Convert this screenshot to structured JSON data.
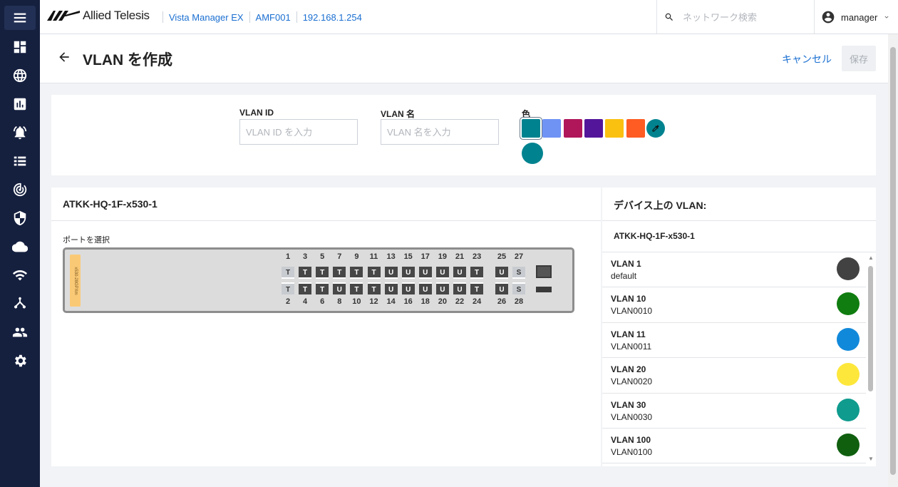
{
  "header": {
    "brand": "Allied Telesis",
    "breadcrumbs": [
      "Vista Manager EX",
      "AMF001",
      "192.168.1.254"
    ],
    "search_placeholder": "ネットワーク検索",
    "user": "manager"
  },
  "sidebar": {
    "icons": [
      "menu-icon",
      "dashboard-icon",
      "globe-icon",
      "chart-icon",
      "alarm-icon",
      "list-icon",
      "radar-icon",
      "shield-icon",
      "cloud-icon",
      "wifi-icon",
      "topology-icon",
      "users-icon",
      "gear-icon"
    ]
  },
  "page": {
    "title": "VLAN を作成",
    "cancel_label": "キャンセル",
    "save_label": "保存"
  },
  "form": {
    "vlan_id_label": "VLAN ID",
    "vlan_id_placeholder": "VLAN ID を入力",
    "vlan_name_label": "VLAN 名",
    "vlan_name_placeholder": "VLAN 名を入力",
    "color_label": "色",
    "swatches": [
      "#00838f",
      "#6f93f5",
      "#b0165a",
      "#53169a",
      "#fbc111",
      "#fe5c23"
    ],
    "selected_color": "#00838f"
  },
  "device": {
    "name": "ATKK-HQ-1F-x530-1",
    "port_select_label": "ポートを選択",
    "model": "x530-28GPXm",
    "top_ports": [
      {
        "n": "1",
        "m": "T",
        "s": "lt"
      },
      {
        "n": "3",
        "m": "T",
        "s": "dk"
      },
      {
        "n": "5",
        "m": "T",
        "s": "dk"
      },
      {
        "n": "7",
        "m": "T",
        "s": "dk"
      },
      {
        "n": "9",
        "m": "T",
        "s": "dk"
      },
      {
        "n": "11",
        "m": "T",
        "s": "dk"
      },
      {
        "n": "13",
        "m": "U",
        "s": "dk"
      },
      {
        "n": "15",
        "m": "U",
        "s": "dk"
      },
      {
        "n": "17",
        "m": "U",
        "s": "dk"
      },
      {
        "n": "19",
        "m": "U",
        "s": "dk"
      },
      {
        "n": "21",
        "m": "U",
        "s": "dk"
      },
      {
        "n": "23",
        "m": "T",
        "s": "dk"
      },
      {
        "n": "25",
        "m": "U",
        "s": "dk"
      },
      {
        "n": "27",
        "m": "S",
        "s": "lt"
      }
    ],
    "bottom_ports": [
      {
        "n": "2",
        "m": "T",
        "s": "lt"
      },
      {
        "n": "4",
        "m": "T",
        "s": "dk"
      },
      {
        "n": "6",
        "m": "T",
        "s": "dk"
      },
      {
        "n": "8",
        "m": "U",
        "s": "dk"
      },
      {
        "n": "10",
        "m": "T",
        "s": "dk"
      },
      {
        "n": "12",
        "m": "T",
        "s": "dk"
      },
      {
        "n": "14",
        "m": "U",
        "s": "dk"
      },
      {
        "n": "16",
        "m": "U",
        "s": "dk"
      },
      {
        "n": "18",
        "m": "U",
        "s": "dk"
      },
      {
        "n": "20",
        "m": "U",
        "s": "dk"
      },
      {
        "n": "22",
        "m": "U",
        "s": "dk"
      },
      {
        "n": "24",
        "m": "T",
        "s": "dk"
      },
      {
        "n": "26",
        "m": "U",
        "s": "dk"
      },
      {
        "n": "28",
        "m": "S",
        "s": "lt"
      }
    ]
  },
  "vlans_panel": {
    "title": "デバイス上の VLAN:",
    "device": "ATKK-HQ-1F-x530-1",
    "items": [
      {
        "name": "VLAN 1",
        "desc": "default",
        "color": "#424242"
      },
      {
        "name": "VLAN 10",
        "desc": "VLAN0010",
        "color": "#0f7d0f"
      },
      {
        "name": "VLAN 11",
        "desc": "VLAN0011",
        "color": "#1189da"
      },
      {
        "name": "VLAN 20",
        "desc": "VLAN0020",
        "color": "#fde73b"
      },
      {
        "name": "VLAN 30",
        "desc": "VLAN0030",
        "color": "#0f9b8e"
      },
      {
        "name": "VLAN 100",
        "desc": "VLAN0100",
        "color": "#0f5f0f"
      }
    ]
  }
}
